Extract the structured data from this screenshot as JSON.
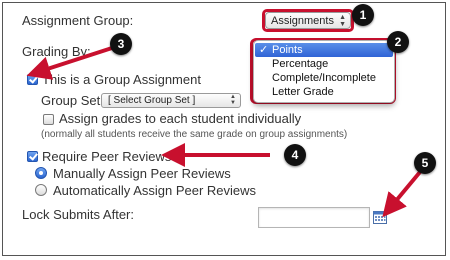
{
  "colors": {
    "annotation_red": "#c8102e",
    "badge_black": "#111111",
    "selected_blue": "#2f63d6"
  },
  "assignment_group": {
    "label": "Assignment Group:",
    "selected": "Assignments"
  },
  "grading": {
    "label": "Grading By:",
    "options": [
      {
        "label": "Points",
        "selected": true
      },
      {
        "label": "Percentage",
        "selected": false
      },
      {
        "label": "Complete/Incomplete",
        "selected": false
      },
      {
        "label": "Letter Grade",
        "selected": false
      }
    ],
    "check_mark": "✓"
  },
  "group_assignment": {
    "label": "This is a Group Assignment",
    "checked": true,
    "group_set_label": "Group Set:",
    "group_set_selected": "[ Select Group Set ]",
    "assign_individually_label": "Assign grades to each student individually",
    "assign_individually_checked": false,
    "note": "(normally all students receive the same grade on group assignments)"
  },
  "peer_reviews": {
    "label": "Require Peer Reviews",
    "checked": true,
    "manual_label": "Manually Assign Peer Reviews",
    "manual_selected": true,
    "auto_label": "Automatically Assign Peer Reviews",
    "auto_selected": false
  },
  "lock": {
    "label": "Lock Submits After:",
    "value": "",
    "icon": "calendar-icon"
  },
  "badges": [
    "1",
    "2",
    "3",
    "4",
    "5"
  ]
}
